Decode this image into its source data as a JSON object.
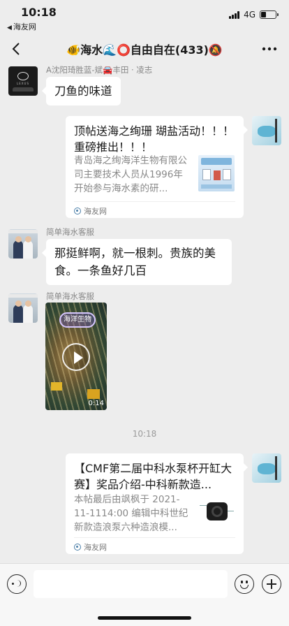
{
  "status_bar": {
    "time": "10:18",
    "back_app": "海友网",
    "network": "4G",
    "battery_level": 0.35
  },
  "nav": {
    "title": "🐠海水🌊⭕自由自在(433)🔕"
  },
  "messages": [
    {
      "sender": "A沈阳琦胜蓝-斌🚘丰田 · 凌志",
      "text": "刀鱼的味道"
    },
    {
      "type": "link-card",
      "title": "顶帖送海之绚珊 瑚盐活动！！！ 重磅推出！！！",
      "desc": "青岛海之绚海洋生物有限公司主要技术人员从1996年开始参与海水素的研...",
      "source": "海友网"
    },
    {
      "sender": "简单海水客服",
      "text": "那挺鲜啊，就一根刺。贵族的美食。一条鱼好几百"
    },
    {
      "sender": "简单海水客服",
      "type": "video",
      "tag": "海洋生物",
      "duration": "0:14"
    }
  ],
  "timestamp": "10:18",
  "messages_after": [
    {
      "type": "link-card",
      "title": "【CMF第二届中科水泵杯开缸大赛】奖品介绍-中科新款造...",
      "desc": "本帖最后由飒枫于 2021-11-1114:00 编辑中科世纪新款造浪泵六种造浪模...",
      "source": "海友网"
    }
  ],
  "icons": {
    "back": "chevron-left-icon",
    "more": "more-dots-icon",
    "voice": "voice-icon",
    "emoji": "emoji-icon",
    "plus": "plus-icon"
  }
}
